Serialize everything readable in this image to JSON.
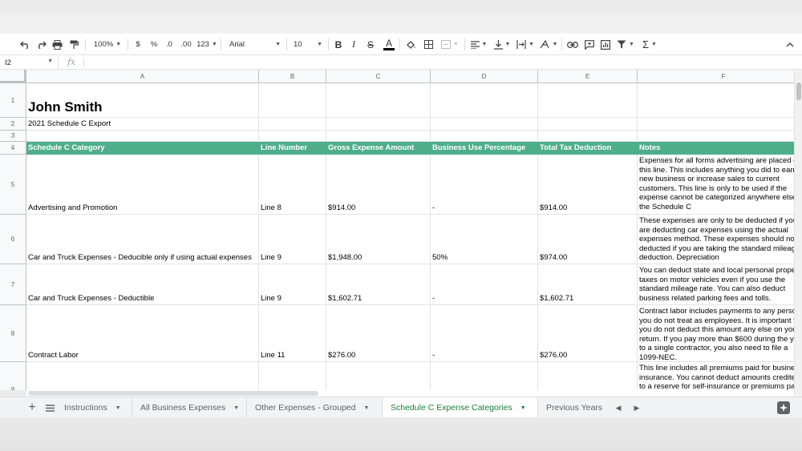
{
  "toolbar": {
    "zoom": "100%",
    "currency": "$",
    "percent": "%",
    "decrease_decimal": ".0",
    "increase_decimal": ".00",
    "more_formats": "123",
    "font": "Arial",
    "font_size": "10",
    "bold": "B",
    "italic": "I",
    "strike": "S",
    "text_color": "A",
    "sum": "Σ"
  },
  "formula_bar": {
    "cell_ref": "I2",
    "fx": "fx",
    "value": ""
  },
  "columns": [
    "A",
    "B",
    "C",
    "D",
    "E",
    "F"
  ],
  "rows": [
    "1",
    "2",
    "3",
    "4",
    "5",
    "6",
    "7",
    "8",
    "9"
  ],
  "sheet": {
    "title": "John Smith",
    "subtitle": "2021 Schedule C Export",
    "headers": [
      "Schedule C Category",
      "Line Number",
      "Gross Expense Amount",
      "Business Use Percentage",
      "Total Tax Deduction",
      "Notes"
    ],
    "data_rows": [
      {
        "category": "Advertising and Promotion",
        "line": "Line 8",
        "gross": "$914.00",
        "pct": "-",
        "deduction": "$914.00",
        "notes": "Expenses for all forms advertising are placed on this line. This includes anything you did to earn new business or increase sales to current customers. This line is only to be used if the expense cannot be categorized anywhere else on the Schedule C"
      },
      {
        "category": "Car and Truck Expenses - Deducible only if using actual expenses",
        "line": "Line 9",
        "gross": "$1,948.00",
        "pct": "50%",
        "deduction": "$974.00",
        "notes": "These expenses are only to be deducted if you are deducting car expenses using the actual expenses method. These expenses should not be deducted if you are taking the standard mileage deduction. Depreciation"
      },
      {
        "category": "Car and Truck Expenses - Deductible",
        "line": "Line 9",
        "gross": "$1,602.71",
        "pct": "-",
        "deduction": "$1,602.71",
        "notes": "You can deduct state and local personal property taxes on motor vehicles even if you use the standard mileage rate. You can also deduct business related parking fees and tolls."
      },
      {
        "category": "Contract Labor",
        "line": "Line 11",
        "gross": "$276.00",
        "pct": "-",
        "deduction": "$276.00",
        "notes": "Contract labor includes payments to any person you do not treat as employees. It is important that you do not deduct this amount any else on your return. If you pay more than $600 during the year to a single contractor, you also need to file a 1099-NEC."
      },
      {
        "category": "",
        "line": "",
        "gross": "",
        "pct": "",
        "deduction": "",
        "notes": "This line includes all premiums paid for business insurance. You cannot deduct amounts credited to a reserve for self-insurance or premiums paid"
      }
    ]
  },
  "tabs": [
    {
      "label": "Instructions",
      "active": false
    },
    {
      "label": "All Business Expenses",
      "active": false
    },
    {
      "label": "Other Expenses - Grouped",
      "active": false
    },
    {
      "label": "Schedule C Expense Categories",
      "active": true
    },
    {
      "label": "Previous Years",
      "active": false
    }
  ],
  "colors": {
    "header_green": "#4fae8a",
    "active_tab": "#188038"
  }
}
